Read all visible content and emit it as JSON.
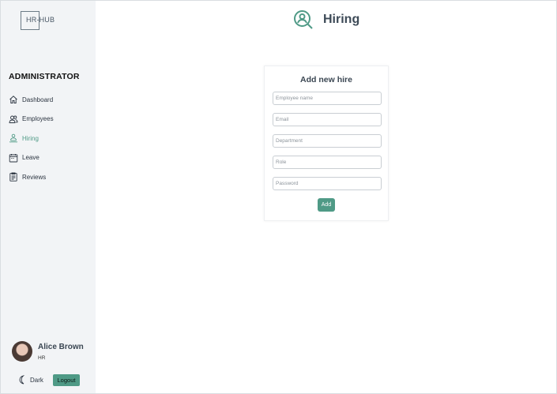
{
  "app": {
    "logo_text": "HR-HUB"
  },
  "sidebar": {
    "role_heading": "ADMINISTRATOR",
    "items": [
      {
        "label": "Dashboard",
        "icon": "home-icon"
      },
      {
        "label": "Employees",
        "icon": "users-icon"
      },
      {
        "label": "Hiring",
        "icon": "hiring-icon",
        "active": true
      },
      {
        "label": "Leave",
        "icon": "calendar-icon"
      },
      {
        "label": "Reviews",
        "icon": "clipboard-icon"
      }
    ],
    "user": {
      "name": "Alice Brown",
      "role": "HR"
    },
    "theme_label": "Dark",
    "logout_label": "Logout"
  },
  "header": {
    "title": "Hiring",
    "icon": "user-search-icon"
  },
  "form": {
    "title": "Add new hire",
    "fields": [
      {
        "placeholder": "Employee name",
        "value": ""
      },
      {
        "placeholder": "Email",
        "value": ""
      },
      {
        "placeholder": "Department",
        "value": ""
      },
      {
        "placeholder": "Role",
        "value": ""
      },
      {
        "placeholder": "Password",
        "value": ""
      }
    ],
    "submit_label": "Add"
  },
  "colors": {
    "accent": "#4f9a86",
    "sidebar_bg": "#f2f4f6",
    "title_text": "#3d4a57"
  }
}
